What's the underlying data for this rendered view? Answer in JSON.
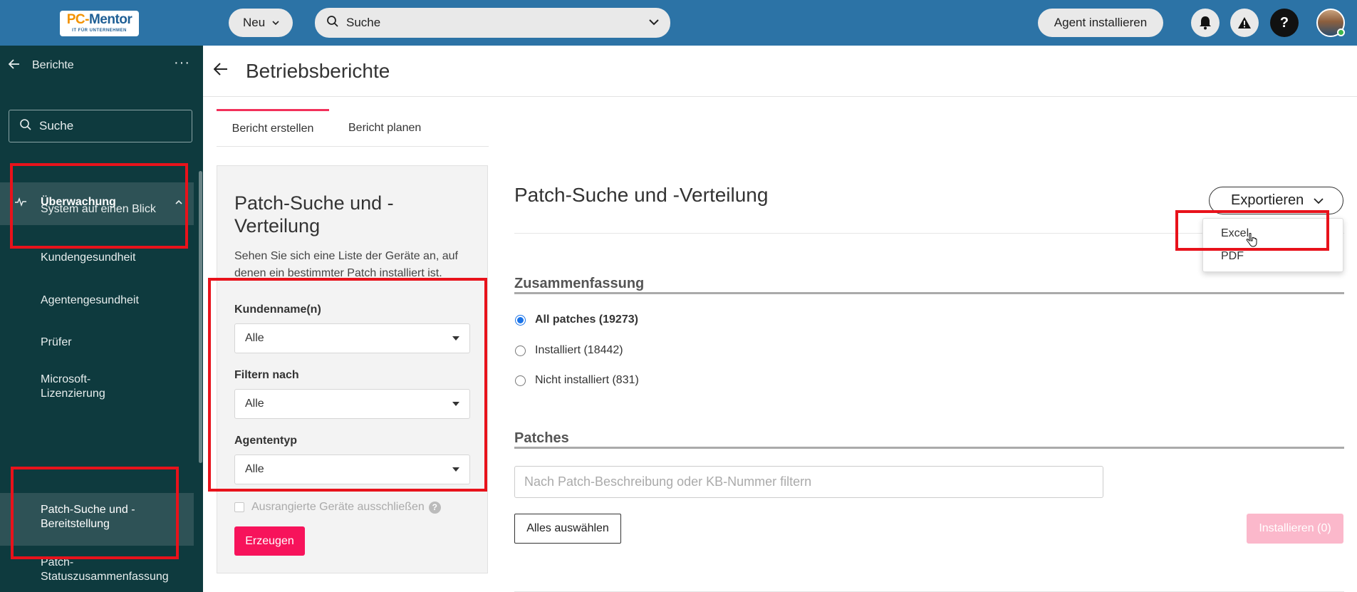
{
  "topbar": {
    "logo_main": "PC-",
    "logo_mentor": "Mentor",
    "logo_sub": "IT FÜR UNTERNEHMEN",
    "new_label": "Neu",
    "search_label": "Suche",
    "agent_install_label": "Agent installieren"
  },
  "sidebar": {
    "title": "Berichte",
    "search_placeholder": "Suche",
    "section_label": "Überwachung",
    "items": [
      {
        "label": "System auf einen Blick"
      },
      {
        "label": "Kundengesundheit"
      },
      {
        "label": "Agentengesundheit"
      },
      {
        "label": "Prüfer"
      },
      {
        "label": "Microsoft-Lizenzierung"
      },
      {
        "label": "Patch-Suche und -Bereitstellung"
      },
      {
        "label": "Patch-Statuszusammenfassung"
      }
    ]
  },
  "main": {
    "title": "Betriebsberichte",
    "tabs": [
      "Bericht erstellen",
      "Bericht planen"
    ]
  },
  "form": {
    "title": "Patch-Suche und -Verteilung",
    "description": "Sehen Sie sich eine Liste der Geräte an, auf denen ein bestimmter Patch installiert ist.",
    "customer_label": "Kundenname(n)",
    "customer_value": "Alle",
    "filter_label": "Filtern nach",
    "filter_value": "Alle",
    "agent_type_label": "Agententyp",
    "agent_type_value": "Alle",
    "exclude_retired_label": "Ausrangierte Geräte ausschließen",
    "generate_label": "Erzeugen"
  },
  "report": {
    "title": "Patch-Suche und -Verteilung",
    "export_label": "Exportieren",
    "export_options": [
      "Excel",
      "PDF"
    ],
    "summary_heading": "Zusammenfassung",
    "summary_options": [
      {
        "label": "All patches (19273)",
        "selected": true
      },
      {
        "label": "Installiert (18442)",
        "selected": false
      },
      {
        "label": "Nicht installiert (831)",
        "selected": false
      }
    ],
    "patches_heading": "Patches",
    "patch_filter_placeholder": "Nach Patch-Beschreibung oder KB-Nummer filtern",
    "select_all_label": "Alles auswählen",
    "install_label": "Installieren (0)"
  },
  "colors": {
    "topbar": "#2c73a6",
    "sidebar": "#0e3a3e",
    "accent_pink": "#f7135b",
    "highlight_red": "#e8121b"
  }
}
